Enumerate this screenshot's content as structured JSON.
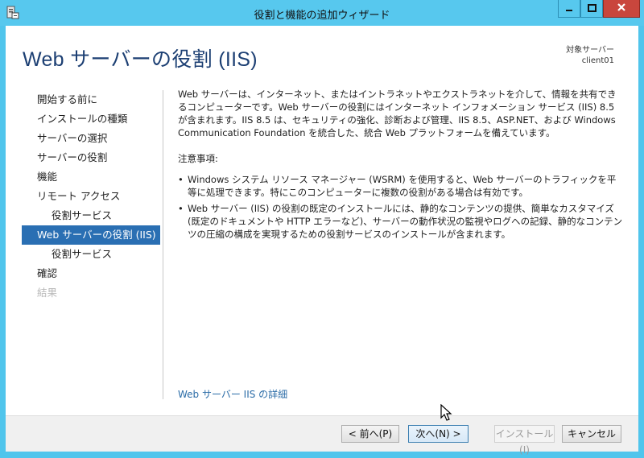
{
  "window": {
    "title": "役割と機能の追加ウィザード",
    "minimize_icon": "minimize-icon",
    "maximize_icon": "maximize-icon",
    "close_icon": "close-icon"
  },
  "header": {
    "page_title": "Web サーバーの役割 (IIS)",
    "target_label": "対象サーバー",
    "target_server": "client01"
  },
  "nav": {
    "items": [
      {
        "label": "開始する前に",
        "state": "normal"
      },
      {
        "label": "インストールの種類",
        "state": "normal"
      },
      {
        "label": "サーバーの選択",
        "state": "normal"
      },
      {
        "label": "サーバーの役割",
        "state": "normal"
      },
      {
        "label": "機能",
        "state": "normal"
      },
      {
        "label": "リモート アクセス",
        "state": "normal"
      },
      {
        "label": "役割サービス",
        "state": "sub"
      },
      {
        "label": "Web サーバーの役割 (IIS)",
        "state": "active"
      },
      {
        "label": "役割サービス",
        "state": "sub"
      },
      {
        "label": "確認",
        "state": "normal"
      },
      {
        "label": "結果",
        "state": "disabled"
      }
    ]
  },
  "content": {
    "intro": "Web サーバーは、インターネット、またはイントラネットやエクストラネットを介して、情報を共有できるコンピューターです。Web サーバーの役割にはインターネット インフォメーション サービス (IIS) 8.5 が含まれます。IIS 8.5 は、セキュリティの強化、診断および管理、IIS 8.5、ASP.NET、および Windows Communication Foundation を統合した、統合 Web プラットフォームを備えています。",
    "notes_heading": "注意事項:",
    "bullets": [
      "Windows システム リソース マネージャー (WSRM) を使用すると、Web サーバーのトラフィックを平等に処理できます。特にこのコンピューターに複数の役割がある場合は有効です。",
      "Web サーバー (IIS) の役割の既定のインストールには、静的なコンテンツの提供、簡単なカスタマイズ (既定のドキュメントや HTTP エラーなど)、サーバーの動作状況の監視やログへの記録、静的なコンテンツの圧縮の構成を実現するための役割サービスのインストールが含まれます。"
    ],
    "details_link": "Web サーバー IIS の詳細"
  },
  "footer": {
    "prev_label": "< 前へ(P)",
    "next_label": "次へ(N) >",
    "install_label": "インストール(I)",
    "cancel_label": "キャンセル"
  },
  "colors": {
    "titlebar": "#57c8ee",
    "nav_active": "#2a6fb3",
    "close_button": "#c9463d",
    "link": "#2b6ca7"
  }
}
